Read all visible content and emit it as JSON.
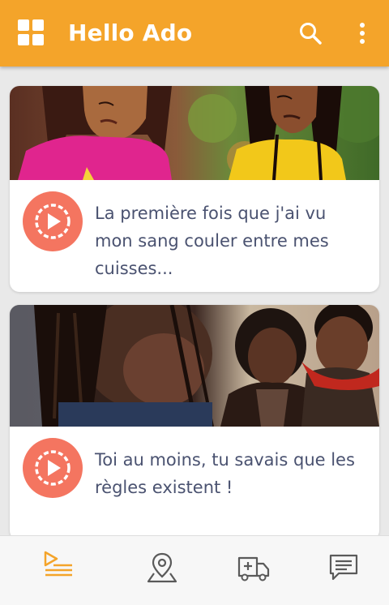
{
  "appbar": {
    "title": "Hello Ado",
    "accent_color": "#f4a42a",
    "icons": [
      "grid-menu-icon",
      "search-icon",
      "more-vert-icon"
    ]
  },
  "feed": {
    "items": [
      {
        "text": "La première fois que j'ai vu mon sang couler entre mes cuisses...",
        "icon": "play-circle-icon"
      },
      {
        "text": "Toi au moins, tu savais que les règles existent !",
        "icon": "play-circle-icon"
      }
    ]
  },
  "bottom_nav": {
    "items": [
      {
        "icon": "video-list-icon",
        "active": true
      },
      {
        "icon": "map-pin-icon",
        "active": false
      },
      {
        "icon": "ambulance-icon",
        "active": false
      },
      {
        "icon": "chat-icon",
        "active": false
      }
    ],
    "active_color": "#f4a42a",
    "inactive_color": "#5a5a5a"
  },
  "play_button_color": "#f47560"
}
